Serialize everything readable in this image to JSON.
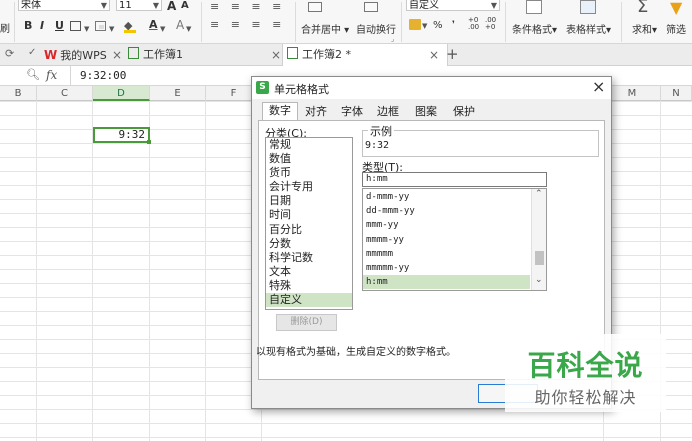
{
  "ribbon": {
    "left_cut_label": "刷",
    "font_name": "宋体",
    "font_size": "11",
    "grow_font": "A",
    "shrink_font": "A",
    "bold": "B",
    "italic": "I",
    "underline": "U",
    "merge_center": "合并居中",
    "wrap_text": "自动换行",
    "number_format": "自定义",
    "percent": "%",
    "thousands": "000",
    "conditional_format": "条件格式",
    "table_style": "表格样式",
    "sum": "求和",
    "filter": "筛选"
  },
  "tabs": [
    {
      "label": "我的WPS",
      "close": "×"
    },
    {
      "label": "工作簿1",
      "close": ""
    },
    {
      "label": "工作簿2 *",
      "close": "×"
    }
  ],
  "tab_add": "+",
  "formula": {
    "fx": "fx",
    "value": "9:32:00"
  },
  "columns": [
    "B",
    "C",
    "D",
    "E",
    "F",
    "M",
    "N"
  ],
  "cell_d": "9:32",
  "dialog": {
    "title": "单元格格式",
    "close": "×",
    "tabs": [
      "数字",
      "对齐",
      "字体",
      "边框",
      "图案",
      "保护"
    ],
    "category_label": "分类(C):",
    "categories": [
      "常规",
      "数值",
      "货币",
      "会计专用",
      "日期",
      "时间",
      "百分比",
      "分数",
      "科学记数",
      "文本",
      "特殊",
      "自定义"
    ],
    "selected_category": "自定义",
    "sample_label": "示例",
    "sample_value": "9:32",
    "type_label": "类型(T):",
    "type_value": "h:mm",
    "formats": [
      "d-mmm-yy",
      "dd-mmm-yy",
      "mmm-yy",
      "mmmm-yy",
      "mmmmm",
      "mmmmm-yy",
      "h:mm"
    ],
    "selected_format": "h:mm",
    "delete_button": "删除(D)",
    "hint": "以现有格式为基础，生成自定义的数字格式。"
  },
  "watermark": {
    "title": "百科全说",
    "subtitle": "助你轻松解决"
  },
  "colors": {
    "accent_green": "#217346",
    "wps_red": "#d9262b",
    "selection_green": "#cfe4c5",
    "watermark_green": "#3aa84a"
  }
}
